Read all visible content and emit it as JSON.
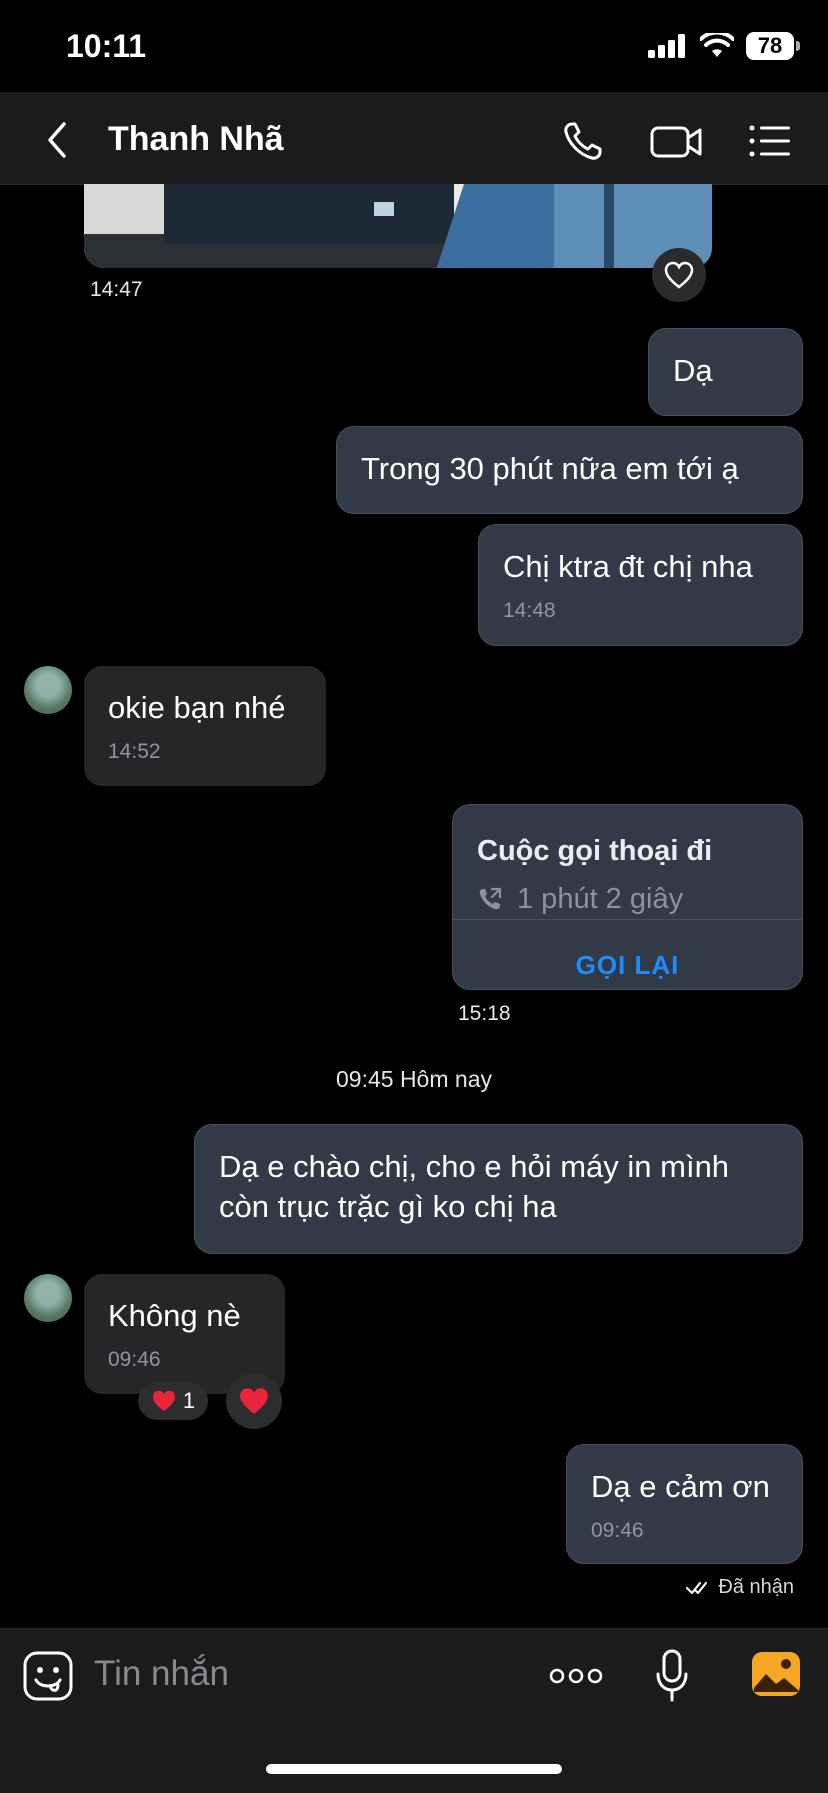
{
  "status_bar": {
    "time": "10:11",
    "battery": "78"
  },
  "header": {
    "contact_name": "Thanh Nhã"
  },
  "messages": {
    "image_time": "14:47",
    "m1": "Dạ",
    "m2": "Trong 30 phút nữa em tới ạ",
    "m3": {
      "text": "Chị ktra đt chị nha",
      "time": "14:48"
    },
    "m4": {
      "text": "okie bạn nhé",
      "time": "14:52"
    },
    "call": {
      "title": "Cuộc gọi thoại đi",
      "duration": "1 phút 2 giây",
      "action": "GỌI LẠI",
      "time": "15:18"
    },
    "date_separator": "09:45 Hôm nay",
    "m5": {
      "text": "Dạ e chào chị, cho e hỏi máy in mình còn trục trặc gì ko chị ha"
    },
    "m6": {
      "text": "Không nè",
      "time": "09:46",
      "reaction_count": "1"
    },
    "m7": {
      "text": "Dạ e cảm ơn",
      "time": "09:46"
    },
    "delivery_status": "Đã nhận"
  },
  "composer": {
    "placeholder": "Tin nhắn"
  },
  "colors": {
    "accent": "#1e8cff",
    "outgoing_bubble": "#323a47",
    "incoming_bubble": "#262629",
    "heart": "#e8253a"
  }
}
